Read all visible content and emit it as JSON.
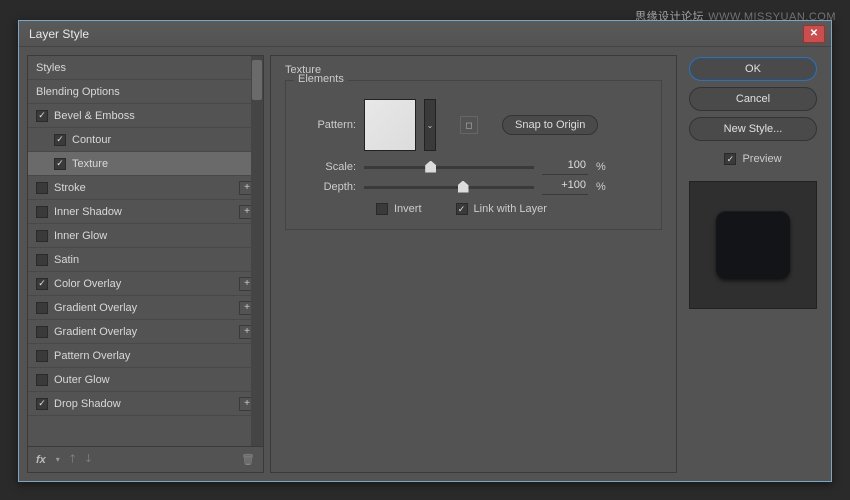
{
  "watermark": {
    "text1": "思缘设计论坛",
    "text2": "WWW.MISSYUAN.COM"
  },
  "dialog": {
    "title": "Layer Style"
  },
  "sidebar": {
    "items": [
      {
        "label": "Styles",
        "kind": "header"
      },
      {
        "label": "Blending Options",
        "kind": "header"
      },
      {
        "label": "Bevel & Emboss",
        "checked": true,
        "add": false
      },
      {
        "label": "Contour",
        "checked": true,
        "indent": true
      },
      {
        "label": "Texture",
        "checked": true,
        "indent": true,
        "selected": true
      },
      {
        "label": "Stroke",
        "checked": false,
        "add": true
      },
      {
        "label": "Inner Shadow",
        "checked": false,
        "add": true
      },
      {
        "label": "Inner Glow",
        "checked": false
      },
      {
        "label": "Satin",
        "checked": false
      },
      {
        "label": "Color Overlay",
        "checked": true,
        "add": true
      },
      {
        "label": "Gradient Overlay",
        "checked": false,
        "add": true
      },
      {
        "label": "Gradient Overlay",
        "checked": false,
        "add": true
      },
      {
        "label": "Pattern Overlay",
        "checked": false
      },
      {
        "label": "Outer Glow",
        "checked": false
      },
      {
        "label": "Drop Shadow",
        "checked": true,
        "add": true
      }
    ],
    "footer": {
      "fx": "fx"
    }
  },
  "main": {
    "groupTitle": "Texture",
    "legend": "Elements",
    "patternLabel": "Pattern:",
    "snapBtn": "Snap to Origin",
    "scale": {
      "label": "Scale:",
      "value": "100",
      "unit": "%",
      "pos": 36
    },
    "depth": {
      "label": "Depth:",
      "value": "+100",
      "unit": "%",
      "pos": 55
    },
    "invert": {
      "label": "Invert",
      "checked": false
    },
    "link": {
      "label": "Link with Layer",
      "checked": true
    }
  },
  "right": {
    "ok": "OK",
    "cancel": "Cancel",
    "newStyle": "New Style...",
    "preview": "Preview"
  }
}
